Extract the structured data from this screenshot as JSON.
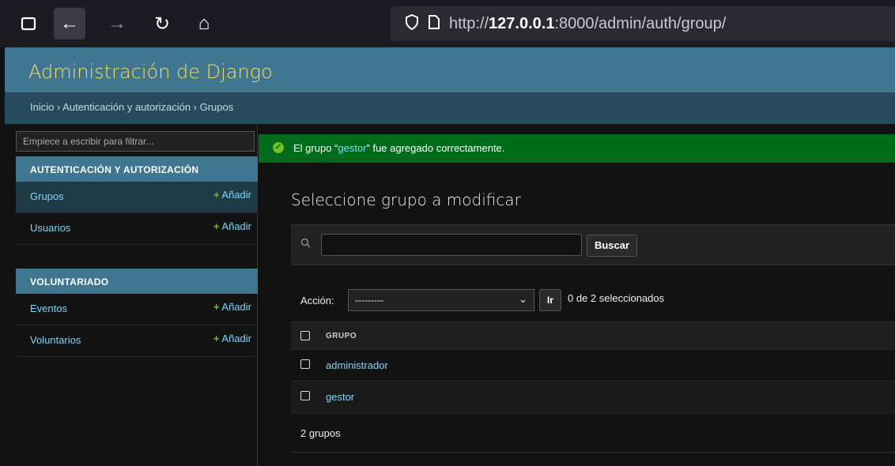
{
  "browser": {
    "url_prefix": "http://",
    "url_host": "127.0.0.1",
    "url_rest": ":8000/admin/auth/group/"
  },
  "header": {
    "brand": "Administración de Django"
  },
  "breadcrumbs": "Inicio › Autenticación y autorización › Grupos",
  "sidebar": {
    "filter_placeholder": "Empiece a escribir para filtrar...",
    "modules": [
      {
        "caption": "AUTENTICACIÓN Y AUTORIZACIÓN",
        "models": [
          {
            "name": "Grupos",
            "add": "Añadir",
            "selected": true
          },
          {
            "name": "Usuarios",
            "add": "Añadir",
            "selected": false
          }
        ]
      },
      {
        "caption": "VOLUNTARIADO",
        "models": [
          {
            "name": "Eventos",
            "add": "Añadir",
            "selected": false
          },
          {
            "name": "Voluntarios",
            "add": "Añadir",
            "selected": false
          }
        ]
      }
    ]
  },
  "message": {
    "before": "El grupo “",
    "highlight": "gestor",
    "after": "” fue agregado correctamente."
  },
  "main": {
    "title": "Seleccione grupo a modificar",
    "search_button": "Buscar",
    "action_label": "Acción:",
    "action_selected": "---------",
    "go_button": "Ir",
    "counter": "0 de 2 seleccionados",
    "column_header": "GRUPO",
    "rows": [
      "administrador",
      "gestor"
    ],
    "paginator": "2 grupos"
  },
  "colors": {
    "header_bg": "#417690",
    "brand": "#f5dd5d",
    "success_bg": "#006b1b",
    "link": "#81d4fa"
  }
}
